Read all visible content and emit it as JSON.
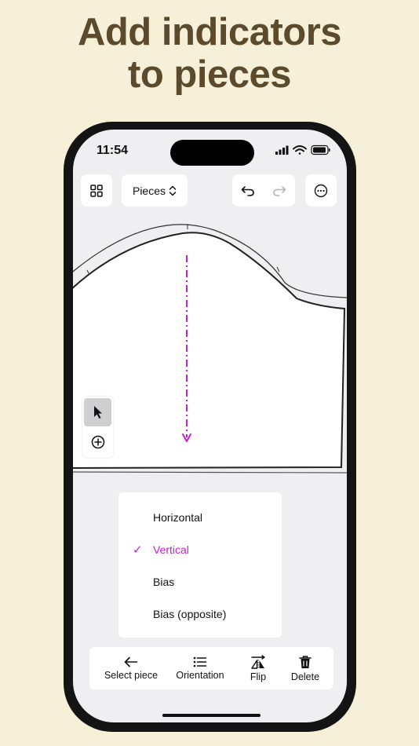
{
  "headline": {
    "line1": "Add indicators",
    "line2": "to pieces"
  },
  "status_bar": {
    "time": "11:54"
  },
  "top_bar": {
    "grid_icon": "grid-icon",
    "pieces_label": "Pieces",
    "undo_icon": "undo-icon",
    "redo_icon": "redo-icon",
    "more_icon": "more-icon"
  },
  "grainline_color": "#c41fd3",
  "tools": {
    "select_icon": "cursor-icon",
    "add_icon": "plus-circle-icon"
  },
  "orientation_menu": {
    "items": [
      {
        "label": "Horizontal",
        "selected": false
      },
      {
        "label": "Vertical",
        "selected": true
      },
      {
        "label": "Bias",
        "selected": false
      },
      {
        "label": "Bias (opposite)",
        "selected": false
      }
    ]
  },
  "toolbar": {
    "select_piece": "Select piece",
    "orientation": "Orientation",
    "flip": "Flip",
    "delete": "Delete"
  },
  "colors": {
    "background": "#f7f0d9",
    "headline": "#5b4a2c",
    "accent": "#c41fd3"
  }
}
